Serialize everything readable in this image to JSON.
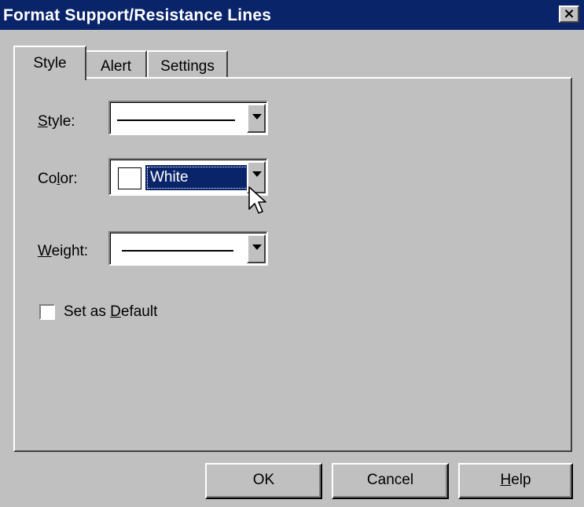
{
  "window": {
    "title": "Format Support/Resistance Lines",
    "close_label": "×"
  },
  "tabs": [
    {
      "label": "Style",
      "active": true
    },
    {
      "label": "Alert",
      "active": false
    },
    {
      "label": "Settings",
      "active": false
    }
  ],
  "fields": {
    "style": {
      "label_mnemonic": "S",
      "label_rest": "tyle:",
      "value": "solid line"
    },
    "color": {
      "label_pre": "Co",
      "label_mnemonic": "l",
      "label_rest": "or:",
      "value": "White",
      "swatch_color": "#ffffff"
    },
    "weight": {
      "label_mnemonic": "W",
      "label_rest": "eight:",
      "value": "thin line"
    }
  },
  "checkbox": {
    "label_pre": "Set as ",
    "label_mnemonic": "D",
    "label_rest": "efault",
    "checked": false
  },
  "buttons": {
    "ok": "OK",
    "cancel": "Cancel",
    "help_mnemonic": "H",
    "help_rest": "elp"
  },
  "colors": {
    "face": "#c0c0c0",
    "titlebar": "#0a246a",
    "highlight": "#0a246a"
  },
  "icons": {
    "close": "close-icon",
    "dropdown": "chevron-down-icon",
    "pointer": "mouse-pointer-icon"
  }
}
